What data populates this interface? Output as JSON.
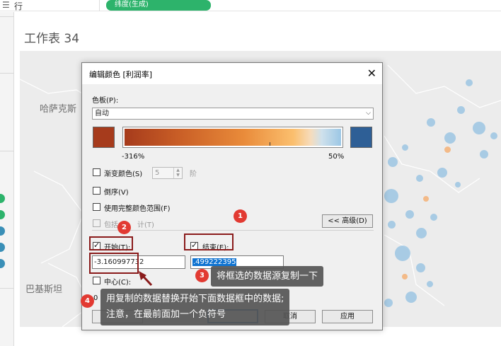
{
  "rows_shelf": {
    "icon": "rows-icon",
    "label": "行",
    "pill": "纬度(生成)"
  },
  "sheet": {
    "title": "工作表 34"
  },
  "map": {
    "labels": {
      "kazakhstan": "哈萨克斯",
      "pakistan": "巴基斯坦"
    }
  },
  "dialog": {
    "title": "编辑颜色 [利润率]",
    "palette_label": "色板(P):",
    "palette_value": "自动",
    "range_min": "-316%",
    "range_max": "50%",
    "stepped_label": "渐变颜色(S)",
    "stepped_value": "5",
    "stepped_unit": "阶",
    "reversed_label": "倒序(V)",
    "full_range_label": "使用完整颜色范围(F)",
    "include_label": "包括",
    "include_suffix": "计(T)",
    "advanced_button": "<< 高级(D)",
    "start_label": "开始(T):",
    "end_label": "结束(E):",
    "start_value": "-3.160997732",
    "end_value": ".499222395",
    "center_label": "中心(C):",
    "reset_partial": "0",
    "cancel_button": "取消",
    "apply_button": "应用"
  },
  "annotations": {
    "badge1": "1",
    "badge2": "2",
    "badge3": "3",
    "badge4": "4",
    "callout3": "将框选的数据源复制一下",
    "callout4_line1": "用复制的数据替换开始下面数据框中的数据;",
    "callout4_line2": "注意，在最前面加一个负符号"
  },
  "colors": {
    "pill": "#2db36b",
    "palette_start": "#a63b1c",
    "palette_end": "#2e5f96",
    "badge": "#e23a32",
    "highlight_box": "#8a1b1b",
    "selection": "#0f73d1"
  }
}
